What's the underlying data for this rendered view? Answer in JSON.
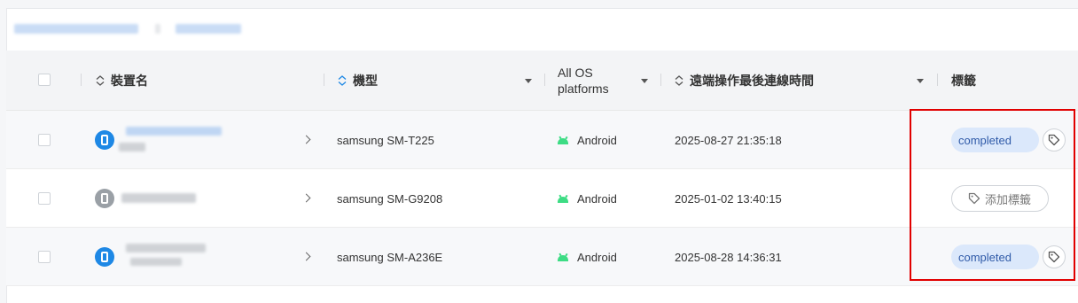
{
  "colors": {
    "accent": "#1e88e5",
    "android_green": "#3ddc84",
    "tag_bg": "#dbe8fb",
    "tag_text": "#2f5aa8",
    "highlight": "#e10000"
  },
  "table": {
    "columns": {
      "device_name": "裝置名",
      "model": "機型",
      "os_platform": "All OS\nplatforms",
      "last_connect": "遠端操作最後連線時間",
      "tags": "標籤"
    },
    "rows": [
      {
        "model": "samsung SM-T225",
        "os": "Android",
        "last_connect": "2025-08-27 21:35:18",
        "tag": "completed",
        "device_status": "online"
      },
      {
        "model": "samsung SM-G9208",
        "os": "Android",
        "last_connect": "2025-01-02 13:40:15",
        "tag": "",
        "add_tag_label": "添加標籤",
        "device_status": "offline"
      },
      {
        "model": "samsung SM-A236E",
        "os": "Android",
        "last_connect": "2025-08-28 14:36:31",
        "tag": "completed",
        "device_status": "online"
      }
    ]
  },
  "icons": {
    "sort": "sort-icon",
    "dropdown": "chevron-down-icon",
    "device": "phone-icon",
    "expand": "chevron-right-icon",
    "os": "android-icon",
    "tag": "tag-icon"
  }
}
